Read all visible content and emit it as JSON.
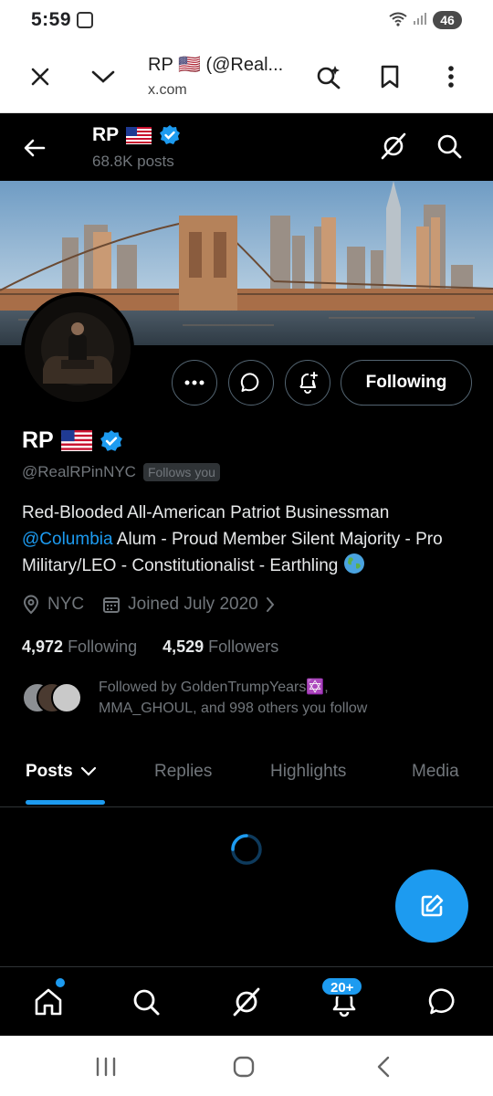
{
  "status_bar": {
    "time": "5:59",
    "battery": "46"
  },
  "browser": {
    "title": "RP 🇺🇸 (@Real...",
    "url": "x.com"
  },
  "header": {
    "name": "RP",
    "posts_count": "68.8K posts"
  },
  "profile": {
    "name": "RP",
    "handle": "@RealRPinNYC",
    "follows_you": "Follows you",
    "bio_part1": "Red-Blooded All-American Patriot Businessman ",
    "bio_link": "@Columbia",
    "bio_part2": " Alum - Proud Member Silent Majority - Pro Military/LEO  - Constitutionalist -  Earthling ",
    "location": "NYC",
    "joined": "Joined July 2020",
    "following_count": "4,972",
    "following_label": "Following",
    "followers_count": "4,529",
    "followers_label": "Followers",
    "followed_by_line1": "Followed by GoldenTrumpYears✡️,",
    "followed_by_line2": "MMA_GHOUL, and 998 others you follow"
  },
  "actions": {
    "following_button": "Following"
  },
  "tabs": [
    {
      "label": "Posts"
    },
    {
      "label": "Replies"
    },
    {
      "label": "Highlights"
    },
    {
      "label": "Media"
    }
  ],
  "bottom_nav": {
    "notifications_badge": "20+"
  },
  "colors": {
    "accent": "#1d9bf0",
    "background": "#000000",
    "muted_text": "#71767b"
  }
}
